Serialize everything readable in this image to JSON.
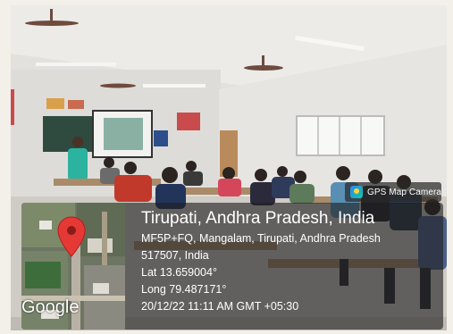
{
  "badge": {
    "label": "GPS Map Camera",
    "icon": "gps-map-camera-icon"
  },
  "map": {
    "provider_logo": "Google",
    "pin_icon": "map-pin-icon",
    "pin_color": "#e53935"
  },
  "location": {
    "title": "Tirupati, Andhra Pradesh, India",
    "address_line1": "MF5P+FQ, Mangalam, Tirupati, Andhra Pradesh",
    "address_line2": "517507, India",
    "latitude": "Lat 13.659004°",
    "longitude": "Long 79.487171°",
    "timestamp": "20/12/22 11:11 AM GMT +05:30"
  }
}
